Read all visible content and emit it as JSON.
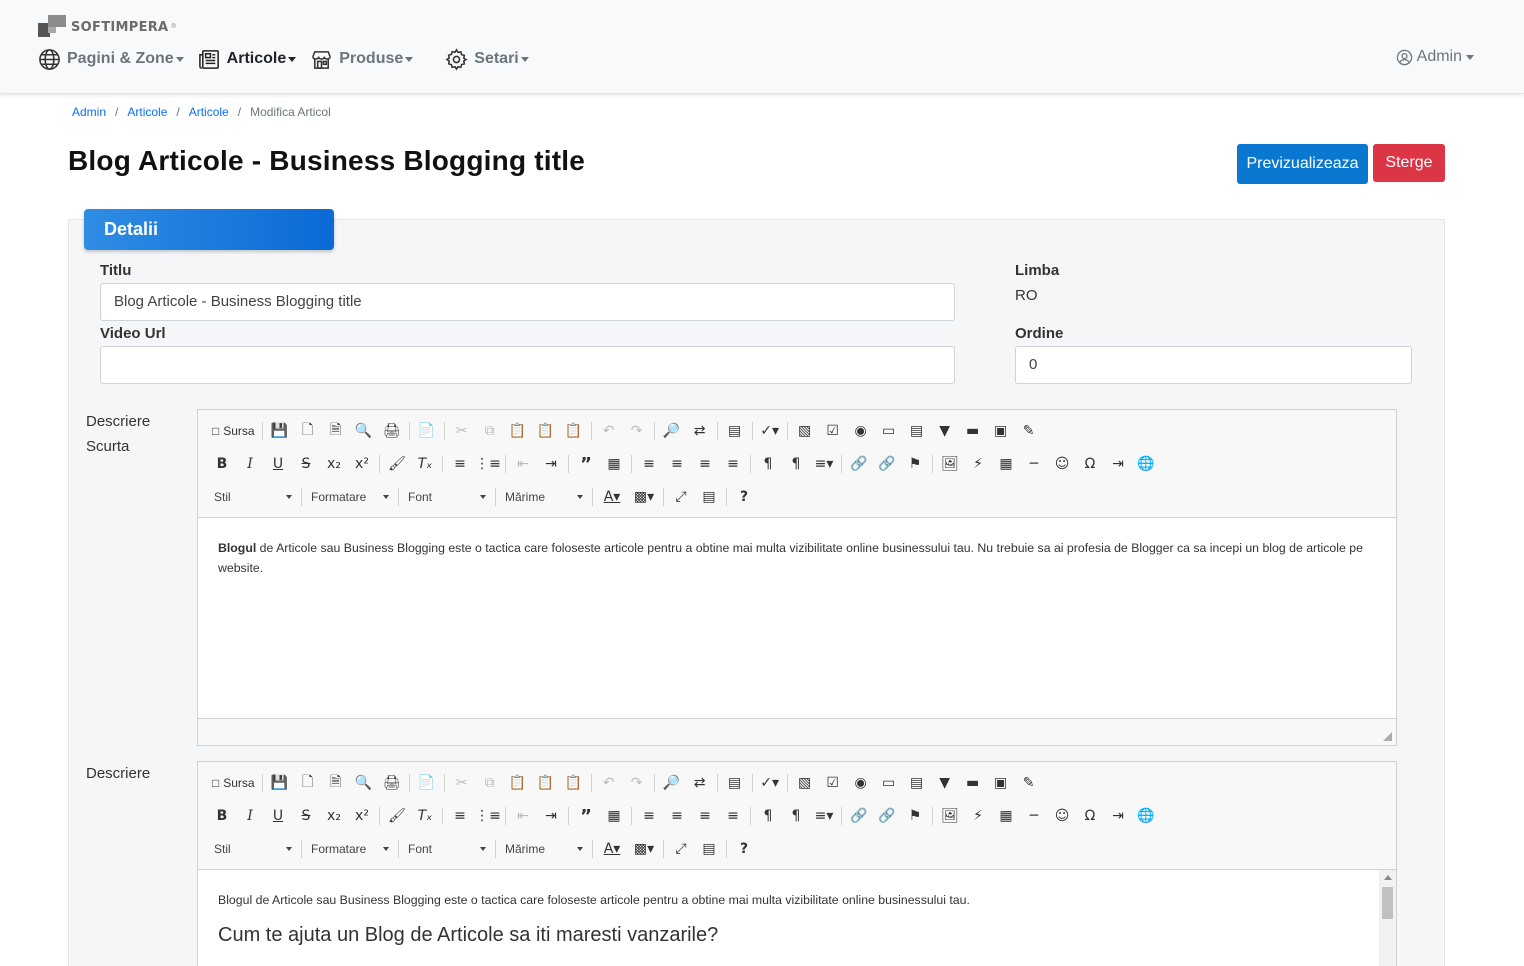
{
  "brand": {
    "name": "SOFTIMPERA",
    "reg": "®"
  },
  "nav": {
    "pages": "Pagini & Zone",
    "articles": "Articole",
    "products": "Produse",
    "settings": "Setari",
    "user": "Admin"
  },
  "breadcrumb": {
    "home": "Admin",
    "level1": "Articole",
    "level2": "Articole",
    "current": "Modifica Articol",
    "sep": "/"
  },
  "page": {
    "title": "Blog Articole - Business Blogging title",
    "preview_label": "Previzualizeaza",
    "delete_label": "Sterge"
  },
  "details": {
    "tab_label": "Detalii",
    "title_label": "Titlu",
    "title_value": "Blog Articole - Business Blogging title",
    "video_label": "Video Url",
    "video_value": "",
    "language_label": "Limba",
    "language_value": "RO",
    "order_label": "Ordine",
    "order_value": "0"
  },
  "short_desc": {
    "label_line1": "Descriere",
    "label_line2": "Scurta",
    "bold_word": "Blogul",
    "text": " de Articole sau Business Blogging este o tactica care foloseste articole pentru a obtine mai multa vizibilitate online businessului tau. Nu trebuie sa ai profesia de Blogger ca sa incepi un blog de articole pe website."
  },
  "description": {
    "label": "Descriere",
    "paragraph": "Blogul de Articole sau Business Blogging este o tactica care foloseste articole pentru a obtine mai multa vizibilitate online businessului tau.",
    "heading": "Cum te ajuta un Blog de Articole sa iti maresti vanzarile?"
  },
  "editor": {
    "source_label": "Sursa",
    "style_label": "Stil",
    "format_label": "Formatare",
    "font_label": "Font",
    "size_label": "Mărime"
  },
  "colors": {
    "primary": "#0a78d1",
    "danger": "#dc3545",
    "tab": "#0a6ad6"
  }
}
